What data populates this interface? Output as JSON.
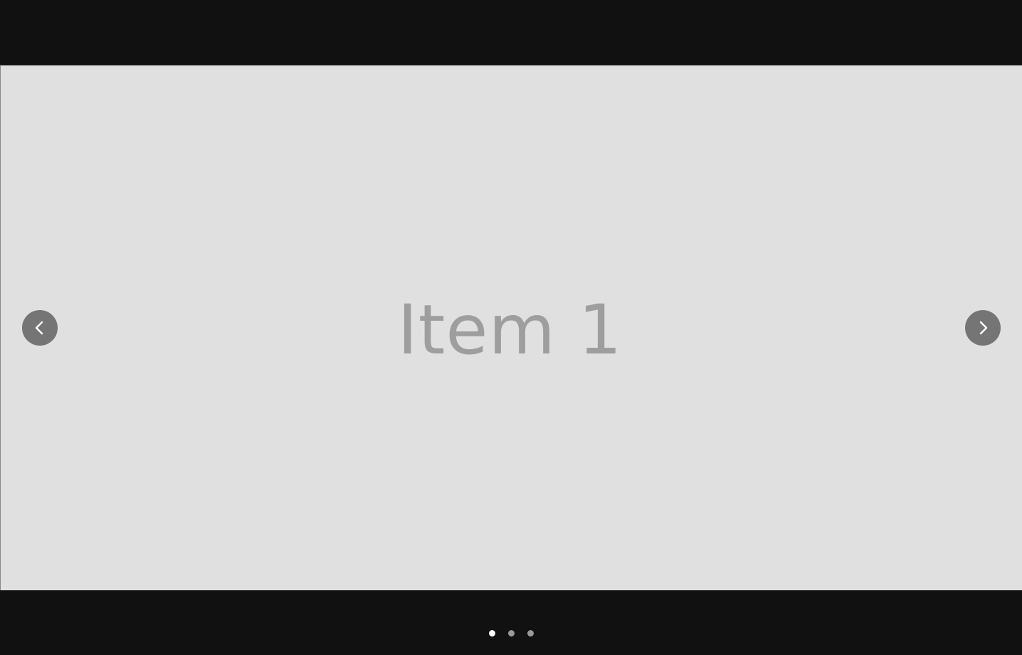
{
  "carousel": {
    "current_index": 1,
    "slides": [
      {
        "label": "Item 1"
      }
    ],
    "indicator_count": 3
  },
  "icons": {
    "prev": "chevron-left-icon",
    "next": "chevron-right-icon"
  },
  "colors": {
    "page_background": "#111111",
    "slide_background": "#e0e0e0",
    "slide_text": "#9e9e9e",
    "nav_button": "#757575",
    "nav_icon": "#ffffff",
    "dot_active": "#ffffff",
    "dot_inactive": "#9a9a9a"
  }
}
